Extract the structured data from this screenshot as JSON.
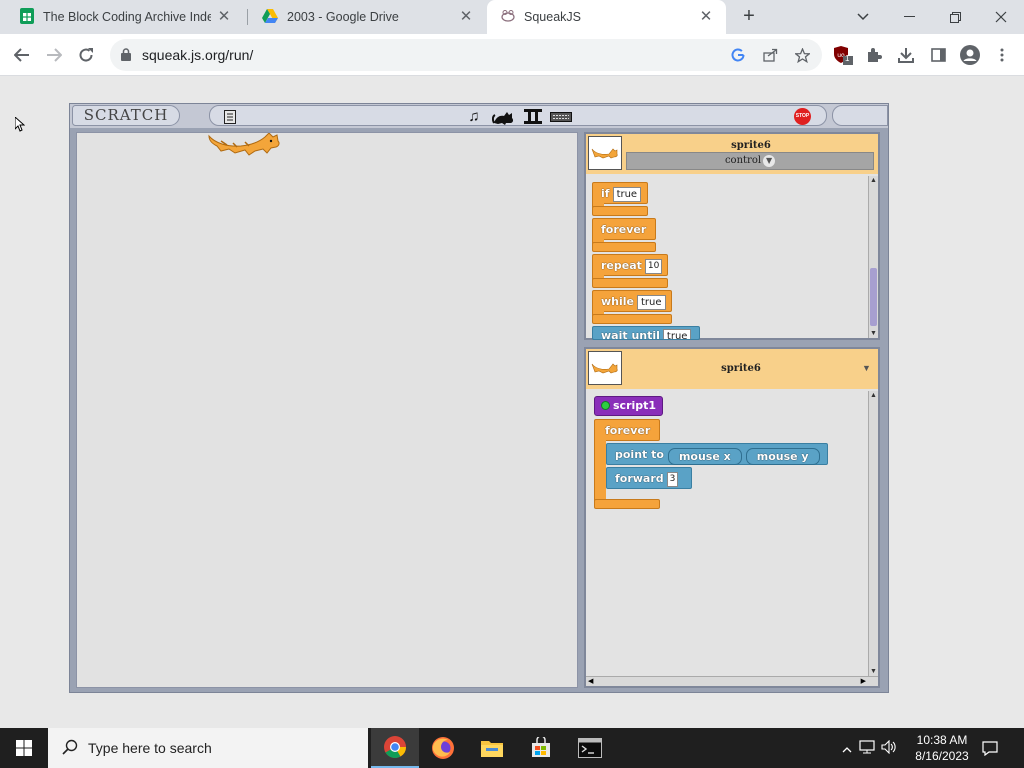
{
  "browser": {
    "tabs": [
      {
        "title": "The Block Coding Archive Index",
        "icon": "sheets-icon",
        "active": false
      },
      {
        "title": "2003 - Google Drive",
        "icon": "drive-icon",
        "active": false
      },
      {
        "title": "SqueakJS",
        "icon": "squeak-icon",
        "active": true
      }
    ],
    "new_tab_symbol": "+",
    "url": "squeak.js.org/run/",
    "extension_badge": "1"
  },
  "scratch": {
    "logo": "SCRATCH",
    "stop_label": "STOP",
    "palette": {
      "sprite_name": "sprite6",
      "category": "control",
      "blocks": [
        {
          "label": "if",
          "arg": "true"
        },
        {
          "label": "forever",
          "arg": ""
        },
        {
          "label": "repeat",
          "arg": "10"
        },
        {
          "label": "while",
          "arg": "true"
        },
        {
          "label": "wait until",
          "arg": "true"
        }
      ]
    },
    "scripts": {
      "sprite_name": "sprite6",
      "hat": "script1",
      "loop": "forever",
      "point_to": "point to",
      "reporter_x": "mouse x",
      "reporter_y": "mouse y",
      "forward": "forward",
      "forward_arg": "3"
    }
  },
  "taskbar": {
    "search_placeholder": "Type here to search",
    "time": "10:38 AM",
    "date": "8/16/2023"
  }
}
